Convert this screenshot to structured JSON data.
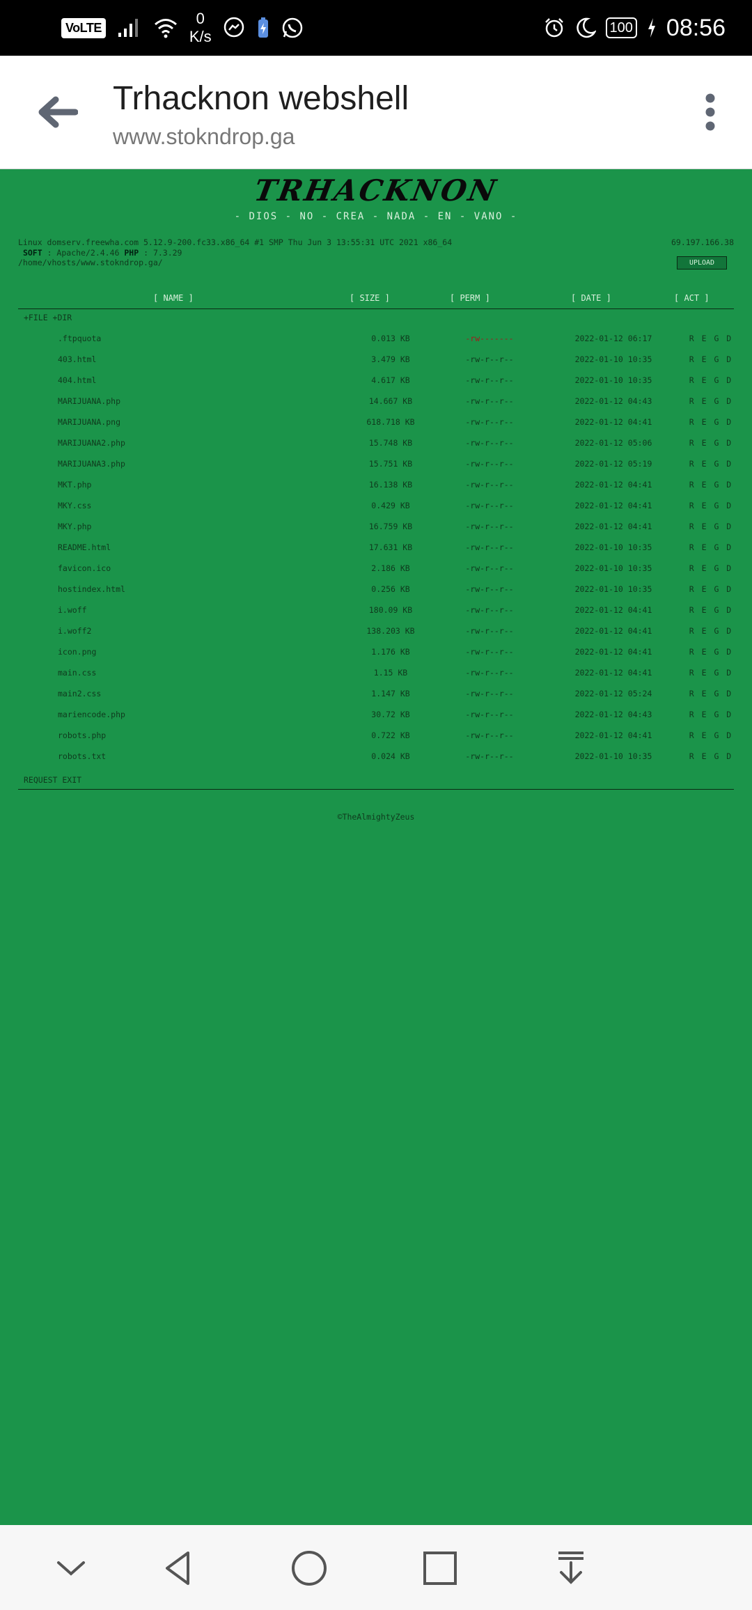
{
  "status_bar": {
    "volte": "VoLTE",
    "speed_value": "0",
    "speed_unit": "K/s",
    "battery": "100",
    "time": "08:56",
    "icons": [
      "signal-icon",
      "wifi-icon",
      "messenger-icon",
      "battery-saver-icon",
      "whatsapp-icon",
      "alarm-icon",
      "moon-icon",
      "charging-icon"
    ]
  },
  "app_bar": {
    "title": "Trhacknon webshell",
    "url": "www.stokndrop.ga"
  },
  "page": {
    "brand": "TRHACKNON",
    "motto": "- DIOS - NO - CREA - NADA - EN - VANO -",
    "system": {
      "uname": "Linux domserv.freewha.com 5.12.9-200.fc33.x86_64 #1 SMP Thu Jun 3 13:55:31 UTC 2021 x86_64",
      "soft_label": "SOFT",
      "soft_value": ": Apache/2.4.46",
      "php_label": "PHP",
      "php_value": ": 7.3.29",
      "path": "/home/vhosts/www.stokndrop.ga/",
      "ip": "69.197.166.38"
    },
    "upload_label": "UPLOAD",
    "columns": {
      "name": "[ NAME ]",
      "size": "[ SIZE ]",
      "perm": "[ PERM ]",
      "date": "[ DATE ]",
      "act": "[ ACT ]"
    },
    "new_file_dir": "+FILE +DIR",
    "files": [
      {
        "name": ".ftpquota",
        "size": "0.013 KB",
        "perm": "-rw-------",
        "date": "2022-01-12 06:17",
        "act": "R E G D"
      },
      {
        "name": "403.html",
        "size": "3.479 KB",
        "perm": "-rw-r--r--",
        "date": "2022-01-10 10:35",
        "act": "R E G D"
      },
      {
        "name": "404.html",
        "size": "4.617 KB",
        "perm": "-rw-r--r--",
        "date": "2022-01-10 10:35",
        "act": "R E G D"
      },
      {
        "name": "MARIJUANA.php",
        "size": "14.667 KB",
        "perm": "-rw-r--r--",
        "date": "2022-01-12 04:43",
        "act": "R E G D"
      },
      {
        "name": "MARIJUANA.png",
        "size": "618.718 KB",
        "perm": "-rw-r--r--",
        "date": "2022-01-12 04:41",
        "act": "R E G D"
      },
      {
        "name": "MARIJUANA2.php",
        "size": "15.748 KB",
        "perm": "-rw-r--r--",
        "date": "2022-01-12 05:06",
        "act": "R E G D"
      },
      {
        "name": "MARIJUANA3.php",
        "size": "15.751 KB",
        "perm": "-rw-r--r--",
        "date": "2022-01-12 05:19",
        "act": "R E G D"
      },
      {
        "name": "MKT.php",
        "size": "16.138 KB",
        "perm": "-rw-r--r--",
        "date": "2022-01-12 04:41",
        "act": "R E G D"
      },
      {
        "name": "MKY.css",
        "size": "0.429 KB",
        "perm": "-rw-r--r--",
        "date": "2022-01-12 04:41",
        "act": "R E G D"
      },
      {
        "name": "MKY.php",
        "size": "16.759 KB",
        "perm": "-rw-r--r--",
        "date": "2022-01-12 04:41",
        "act": "R E G D"
      },
      {
        "name": "README.html",
        "size": "17.631 KB",
        "perm": "-rw-r--r--",
        "date": "2022-01-10 10:35",
        "act": "R E G D"
      },
      {
        "name": "favicon.ico",
        "size": "2.186 KB",
        "perm": "-rw-r--r--",
        "date": "2022-01-10 10:35",
        "act": "R E G D"
      },
      {
        "name": "hostindex.html",
        "size": "0.256 KB",
        "perm": "-rw-r--r--",
        "date": "2022-01-10 10:35",
        "act": "R E G D"
      },
      {
        "name": "i.woff",
        "size": "180.09 KB",
        "perm": "-rw-r--r--",
        "date": "2022-01-12 04:41",
        "act": "R E G D"
      },
      {
        "name": "i.woff2",
        "size": "138.203 KB",
        "perm": "-rw-r--r--",
        "date": "2022-01-12 04:41",
        "act": "R E G D"
      },
      {
        "name": "icon.png",
        "size": "1.176 KB",
        "perm": "-rw-r--r--",
        "date": "2022-01-12 04:41",
        "act": "R E G D"
      },
      {
        "name": "main.css",
        "size": "1.15 KB",
        "perm": "-rw-r--r--",
        "date": "2022-01-12 04:41",
        "act": "R E G D"
      },
      {
        "name": "main2.css",
        "size": "1.147 KB",
        "perm": "-rw-r--r--",
        "date": "2022-01-12 05:24",
        "act": "R E G D"
      },
      {
        "name": "mariencode.php",
        "size": "30.72 KB",
        "perm": "-rw-r--r--",
        "date": "2022-01-12 04:43",
        "act": "R E G D"
      },
      {
        "name": "robots.php",
        "size": "0.722 KB",
        "perm": "-rw-r--r--",
        "date": "2022-01-12 04:41",
        "act": "R E G D"
      },
      {
        "name": "robots.txt",
        "size": "0.024 KB",
        "perm": "-rw-r--r--",
        "date": "2022-01-10 10:35",
        "act": "R E G D"
      }
    ],
    "request_exit": "REQUEST EXIT",
    "copyright": "©TheAlmightyZeus"
  },
  "colors": {
    "page_bg": "#1b944a",
    "text_dark": "#0f3a1d",
    "text_light": "#d8f0dc",
    "restricted_perm": "#a11d1d"
  },
  "nav_bar": {
    "icons": [
      "collapse-icon",
      "back-triangle-icon",
      "home-circle-icon",
      "recents-square-icon",
      "download-icon"
    ]
  }
}
